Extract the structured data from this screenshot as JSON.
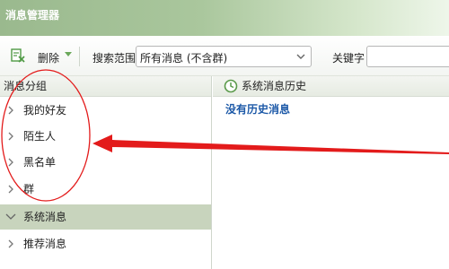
{
  "window": {
    "title": "消息管理器"
  },
  "toolbar": {
    "delete_label": "删除",
    "scope_label": "搜索范围",
    "scope_value": "所有消息 (不含群)",
    "keyword_label": "关键字",
    "keyword_value": ""
  },
  "sidebar": {
    "header": "消息分组",
    "items": [
      {
        "label": "我的好友",
        "selected": false
      },
      {
        "label": "陌生人",
        "selected": false
      },
      {
        "label": "黑名单",
        "selected": false
      },
      {
        "label": "群",
        "selected": false
      },
      {
        "label": "系统消息",
        "selected": true
      },
      {
        "label": "推荐消息",
        "selected": false
      }
    ]
  },
  "main": {
    "header": "系统消息历史",
    "empty_text": "没有历史消息"
  },
  "colors": {
    "accent_green": "#6aa85a",
    "link_blue": "#1e5aa8",
    "annotation_red": "#e31b1b",
    "selected_bg": "#c8d4bd"
  },
  "icons": {
    "delete": "delete-icon",
    "dropdown": "chevron-down-icon",
    "tree_collapsed": "chevron-right-icon",
    "tree_expanded": "chevron-down-icon",
    "history": "clock-icon"
  }
}
